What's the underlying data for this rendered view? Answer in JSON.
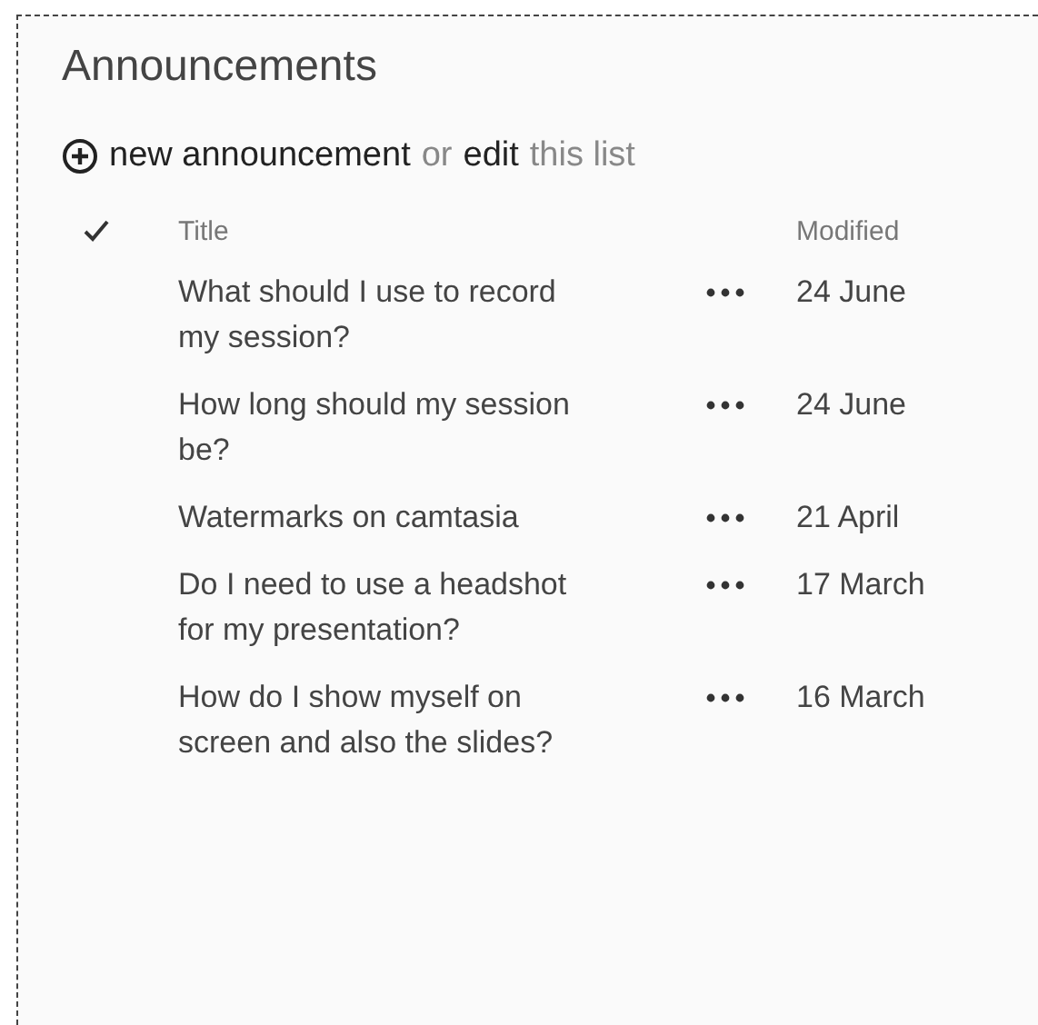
{
  "title": "Announcements",
  "actions": [
    {
      "kind": "link",
      "text": "new announcement"
    },
    {
      "kind": "text",
      "text": "or"
    },
    {
      "kind": "link",
      "text": "edit"
    },
    {
      "kind": "text",
      "text": "this list"
    }
  ],
  "columns": [
    "Title",
    "Modified"
  ],
  "rows": [
    {
      "title": "What should I use to record my session?",
      "modified": "24 June"
    },
    {
      "title": "How long should my session be?",
      "modified": "24 June"
    },
    {
      "title": "Watermarks on camtasia",
      "modified": "21 April"
    },
    {
      "title": "Do I need to use a headshot for my presentation?",
      "modified": "17 March"
    },
    {
      "title": "How do I show myself on screen and also the slides?",
      "modified": "16 March"
    }
  ]
}
